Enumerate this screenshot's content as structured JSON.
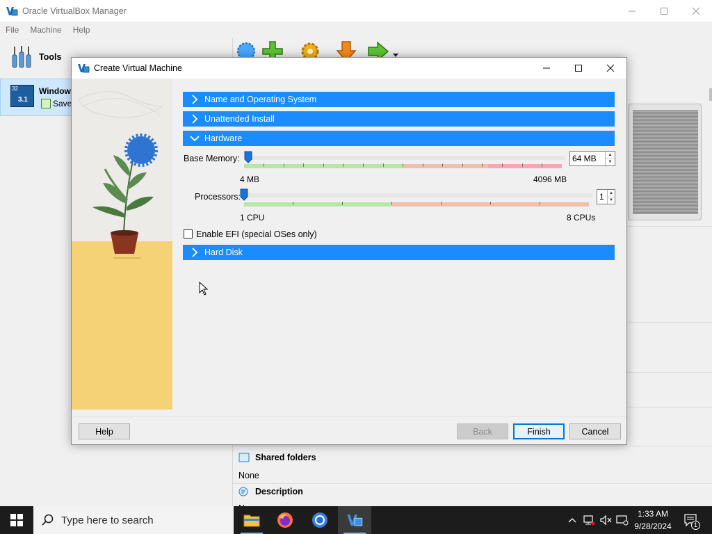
{
  "main_window": {
    "title": "Oracle VirtualBox Manager",
    "menu": [
      "File",
      "Machine",
      "Help"
    ],
    "tools_label": "Tools",
    "vm": {
      "name": "Window",
      "state": "Saved",
      "icon_badge": "3.1",
      "icon_bits": "32"
    }
  },
  "details": {
    "shared_folders": {
      "title": "Shared folders",
      "value": "None"
    },
    "description": {
      "title": "Description",
      "value": "None"
    }
  },
  "dialog": {
    "title": "Create Virtual Machine",
    "sections": {
      "name_os": "Name and Operating System",
      "unattended": "Unattended Install",
      "hardware": "Hardware",
      "hard_disk": "Hard Disk"
    },
    "hardware": {
      "base_memory_label": "Base Memory:",
      "base_memory_value": "64 MB",
      "memory_min": "4 MB",
      "memory_max": "4096 MB",
      "processors_label": "Processors:",
      "processors_value": "1",
      "cpu_min": "1 CPU",
      "cpu_max": "8 CPUs",
      "efi_label": "Enable EFI (special OSes only)",
      "efi_checked": false
    },
    "buttons": {
      "help": "Help",
      "back": "Back",
      "finish": "Finish",
      "cancel": "Cancel"
    }
  },
  "taskbar": {
    "search_placeholder": "Type here to search",
    "time": "1:33 AM",
    "date": "9/28/2024",
    "notification_count": "1"
  },
  "colors": {
    "accent": "#1a8cff",
    "taskbar": "#1c1c1c"
  }
}
